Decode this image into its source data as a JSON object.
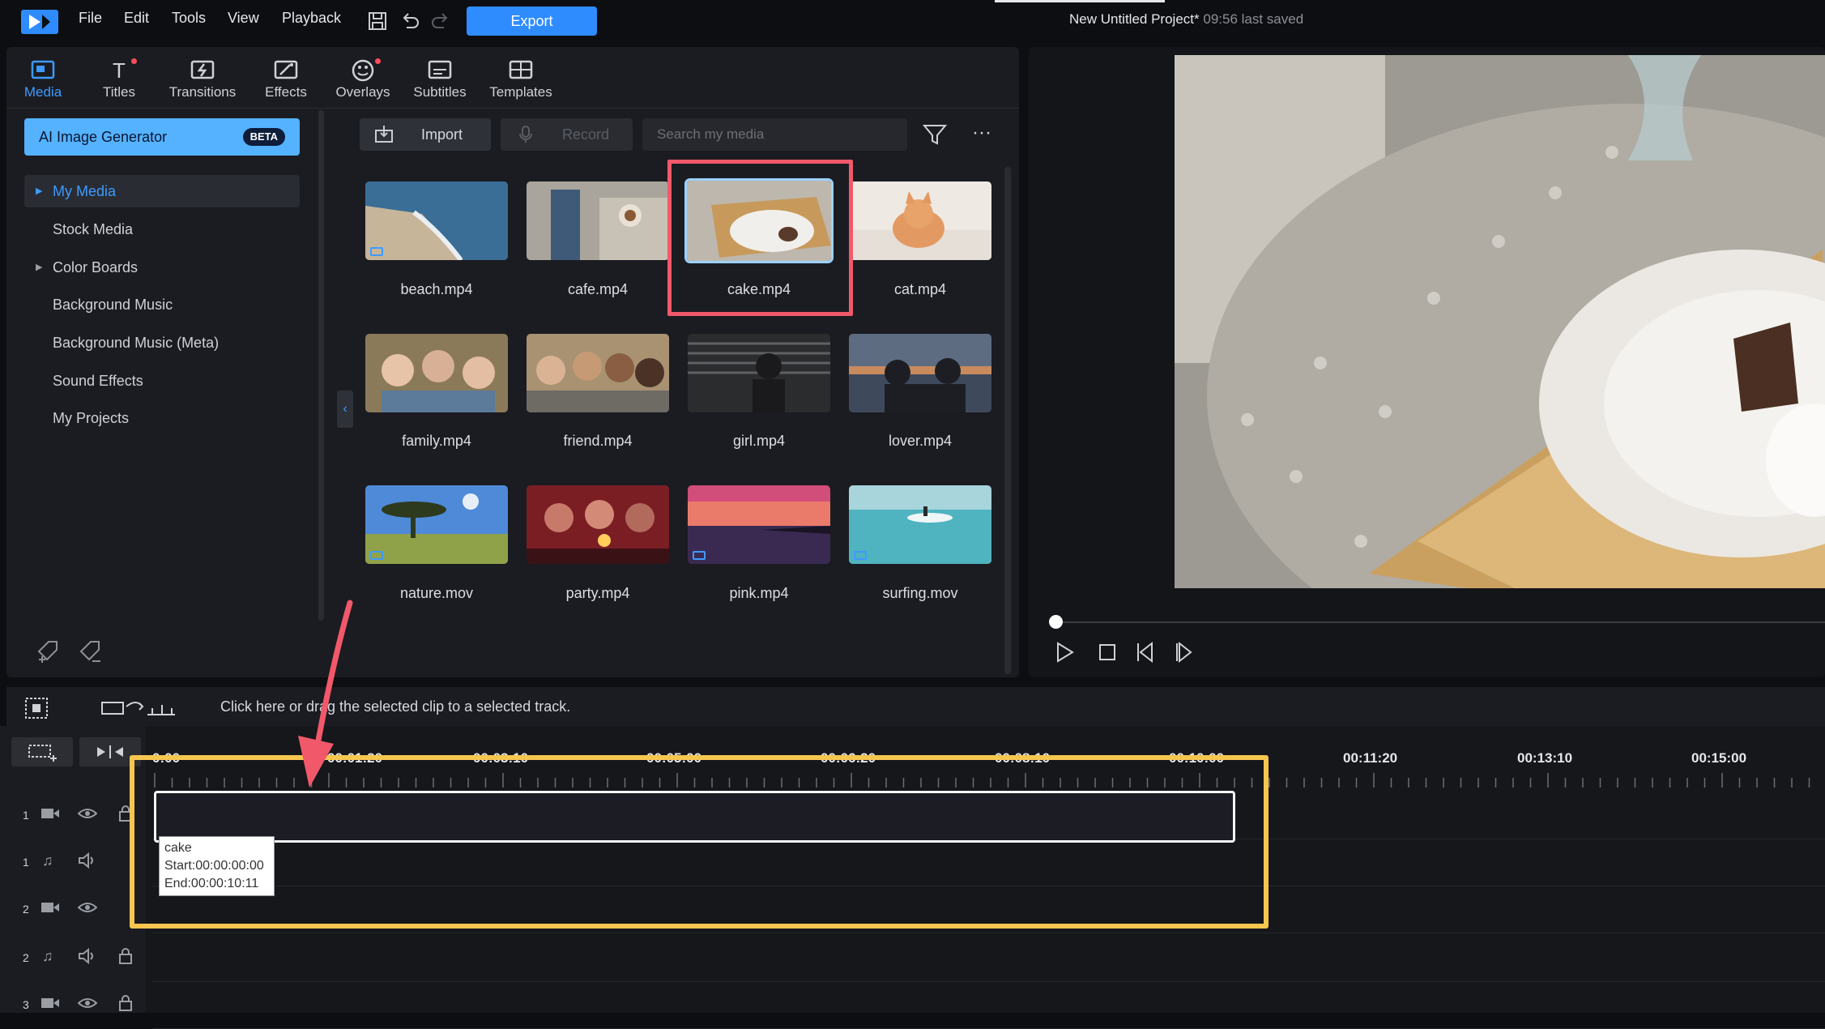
{
  "menu": {
    "items": [
      "File",
      "Edit",
      "Tools",
      "View",
      "Playback"
    ],
    "export_label": "Export",
    "project_title": "New Untitled Project*",
    "last_saved": "09:56 last saved"
  },
  "tabs": [
    {
      "label": "Media",
      "icon": "media-icon",
      "active": true
    },
    {
      "label": "Titles",
      "icon": "titles-icon"
    },
    {
      "label": "Transitions",
      "icon": "transitions-icon"
    },
    {
      "label": "Effects",
      "icon": "effects-icon"
    },
    {
      "label": "Overlays",
      "icon": "overlays-icon"
    },
    {
      "label": "Subtitles",
      "icon": "subtitles-icon"
    },
    {
      "label": "Templates",
      "icon": "templates-icon"
    }
  ],
  "sidebar": {
    "ai_label": "AI Image Generator",
    "beta": "BETA",
    "items": [
      {
        "label": "My Media",
        "active": true,
        "expandable": true
      },
      {
        "label": "Stock Media"
      },
      {
        "label": "Color Boards",
        "expandable": true
      },
      {
        "label": "Background Music"
      },
      {
        "label": "Background Music (Meta)"
      },
      {
        "label": "Sound Effects"
      },
      {
        "label": "My Projects"
      }
    ]
  },
  "media_toolbar": {
    "import_label": "Import",
    "record_label": "Record",
    "search_placeholder": "Search my media"
  },
  "media": [
    {
      "name": "beach.mp4",
      "video_badge": true
    },
    {
      "name": "cafe.mp4"
    },
    {
      "name": "cake.mp4",
      "selected": true
    },
    {
      "name": "cat.mp4"
    },
    {
      "name": "family.mp4"
    },
    {
      "name": "friend.mp4"
    },
    {
      "name": "girl.mp4"
    },
    {
      "name": "lover.mp4"
    },
    {
      "name": "nature.mov",
      "video_badge": true
    },
    {
      "name": "party.mp4"
    },
    {
      "name": "pink.mp4",
      "video_badge": true
    },
    {
      "name": "surfing.mov",
      "video_badge": true
    }
  ],
  "timeline": {
    "hint": "Click here or drag the selected clip to a selected track.",
    "ruler_labels": [
      "0:00",
      "00:01:20",
      "00:03:10",
      "00:05:00",
      "00:06:20",
      "00:08:10",
      "00:10:00",
      "00:11:20",
      "00:13:10",
      "00:15:00"
    ],
    "tracks": [
      {
        "num": "1",
        "type": "video"
      },
      {
        "num": "1",
        "type": "audio"
      },
      {
        "num": "2",
        "type": "video"
      },
      {
        "num": "2",
        "type": "audio"
      },
      {
        "num": "3",
        "type": "video"
      }
    ],
    "tooltip": {
      "name": "cake",
      "start": "Start:00:00:00:00",
      "end": "End:00:00:10:11"
    }
  },
  "colors": {
    "accent": "#3d9bff",
    "export": "#2f8cff",
    "highlight_red": "#f1596a",
    "highlight_yellow": "#f6c64f"
  }
}
